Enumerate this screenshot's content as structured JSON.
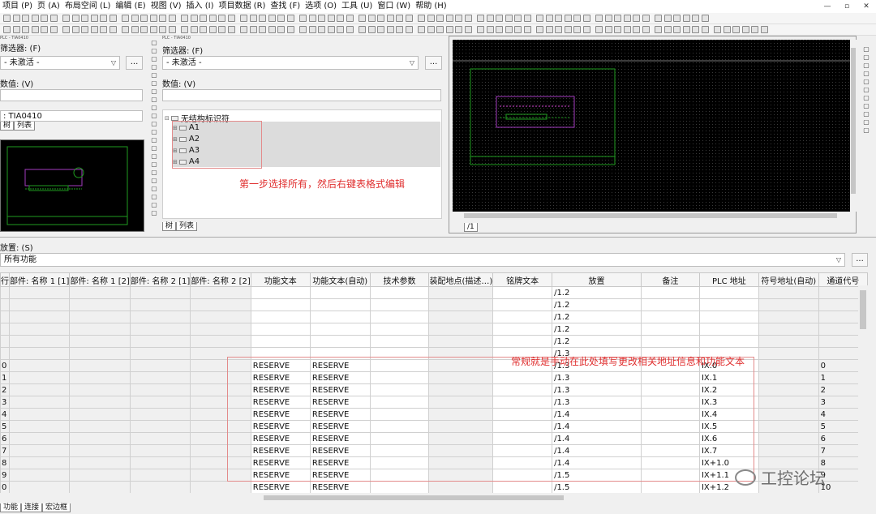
{
  "menu": [
    "项目 (P)",
    "页 (A)",
    "布局空间 (L)",
    "编辑 (E)",
    "视图 (V)",
    "插入 (I)",
    "项目数据 (R)",
    "查找 (F)",
    "选项 (O)",
    "工具 (U)",
    "窗口 (W)",
    "帮助 (H)"
  ],
  "window_controls": [
    "—",
    "▫",
    "✕"
  ],
  "left_panel": {
    "title": "PLC - TIA0410",
    "filter_label": "筛选器: (F)",
    "filter_value": "- 未激活 -",
    "more_btn": "...",
    "value_label": "数值: (V)",
    "value": "",
    "project_value": ": TIA0410",
    "tabs": [
      "树",
      "列表"
    ]
  },
  "mid_panel": {
    "title": "PLC - TIA0410",
    "filter_label": "筛选器: (F)",
    "filter_value": "- 未激活 -",
    "more_btn": "...",
    "value_label": "数值: (V)",
    "value": "",
    "tree_root": "无结构标识符",
    "tree_items": [
      "A1",
      "A2",
      "A3",
      "A4"
    ],
    "tabs": [
      "树",
      "列表"
    ]
  },
  "annotations": {
    "step1": "第一步选择所有，然后右键表格式编辑",
    "step2": "常规就是手动在此处填写更改相关地址信息和功能文本"
  },
  "graphic_tab": "/1",
  "bottom": {
    "placement_label": "放置: (S)",
    "function_filter": "所有功能",
    "more_btn": "...",
    "columns": [
      "行",
      "部件: 名称 1 [1]",
      "部件: 名称 1 [2]",
      "部件: 名称 2 [1]",
      "部件: 名称 2 [2]",
      "功能文本",
      "功能文本(自动)",
      "技术参数",
      "装配地点(描述…)",
      "铭牌文本",
      "放置",
      "备注",
      "PLC 地址",
      "符号地址(自动)",
      "通道代号"
    ],
    "rows": [
      [
        "",
        "",
        "",
        "",
        "",
        "",
        "",
        "",
        "",
        "",
        "/1.2",
        "",
        "",
        "",
        ""
      ],
      [
        "",
        "",
        "",
        "",
        "",
        "",
        "",
        "",
        "",
        "",
        "/1.2",
        "",
        "",
        "",
        ""
      ],
      [
        "",
        "",
        "",
        "",
        "",
        "",
        "",
        "",
        "",
        "",
        "/1.2",
        "",
        "",
        "",
        ""
      ],
      [
        "",
        "",
        "",
        "",
        "",
        "",
        "",
        "",
        "",
        "",
        "/1.2",
        "",
        "",
        "",
        ""
      ],
      [
        "",
        "",
        "",
        "",
        "",
        "",
        "",
        "",
        "",
        "",
        "/1.2",
        "",
        "",
        "",
        ""
      ],
      [
        "",
        "",
        "",
        "",
        "",
        "",
        "",
        "",
        "",
        "",
        "/1.3",
        "",
        "",
        "",
        ""
      ],
      [
        "0",
        "",
        "",
        "",
        "",
        "RESERVE",
        "RESERVE",
        "",
        "",
        "",
        "/1.3",
        "",
        "IX.0",
        "",
        "0"
      ],
      [
        "1",
        "",
        "",
        "",
        "",
        "RESERVE",
        "RESERVE",
        "",
        "",
        "",
        "/1.3",
        "",
        "IX.1",
        "",
        "1"
      ],
      [
        "2",
        "",
        "",
        "",
        "",
        "RESERVE",
        "RESERVE",
        "",
        "",
        "",
        "/1.3",
        "",
        "IX.2",
        "",
        "2"
      ],
      [
        "3",
        "",
        "",
        "",
        "",
        "RESERVE",
        "RESERVE",
        "",
        "",
        "",
        "/1.3",
        "",
        "IX.3",
        "",
        "3"
      ],
      [
        "4",
        "",
        "",
        "",
        "",
        "RESERVE",
        "RESERVE",
        "",
        "",
        "",
        "/1.4",
        "",
        "IX.4",
        "",
        "4"
      ],
      [
        "5",
        "",
        "",
        "",
        "",
        "RESERVE",
        "RESERVE",
        "",
        "",
        "",
        "/1.4",
        "",
        "IX.5",
        "",
        "5"
      ],
      [
        "6",
        "",
        "",
        "",
        "",
        "RESERVE",
        "RESERVE",
        "",
        "",
        "",
        "/1.4",
        "",
        "IX.6",
        "",
        "6"
      ],
      [
        "7",
        "",
        "",
        "",
        "",
        "RESERVE",
        "RESERVE",
        "",
        "",
        "",
        "/1.4",
        "",
        "IX.7",
        "",
        "7"
      ],
      [
        "8",
        "",
        "",
        "",
        "",
        "RESERVE",
        "RESERVE",
        "",
        "",
        "",
        "/1.4",
        "",
        "IX+1.0",
        "",
        "8"
      ],
      [
        "9",
        "",
        "",
        "",
        "",
        "RESERVE",
        "RESERVE",
        "",
        "",
        "",
        "/1.5",
        "",
        "IX+1.1",
        "",
        "9"
      ],
      [
        "0",
        "",
        "",
        "",
        "",
        "RESERVE",
        "RESERVE",
        "",
        "",
        "",
        "/1.5",
        "",
        "IX+1.2",
        "",
        "10"
      ]
    ],
    "tabs": [
      "功能",
      "连接",
      "宏边框"
    ]
  },
  "watermark": "工控论坛",
  "colors": {
    "annotation": "#e03030",
    "canvas": "#000000"
  }
}
